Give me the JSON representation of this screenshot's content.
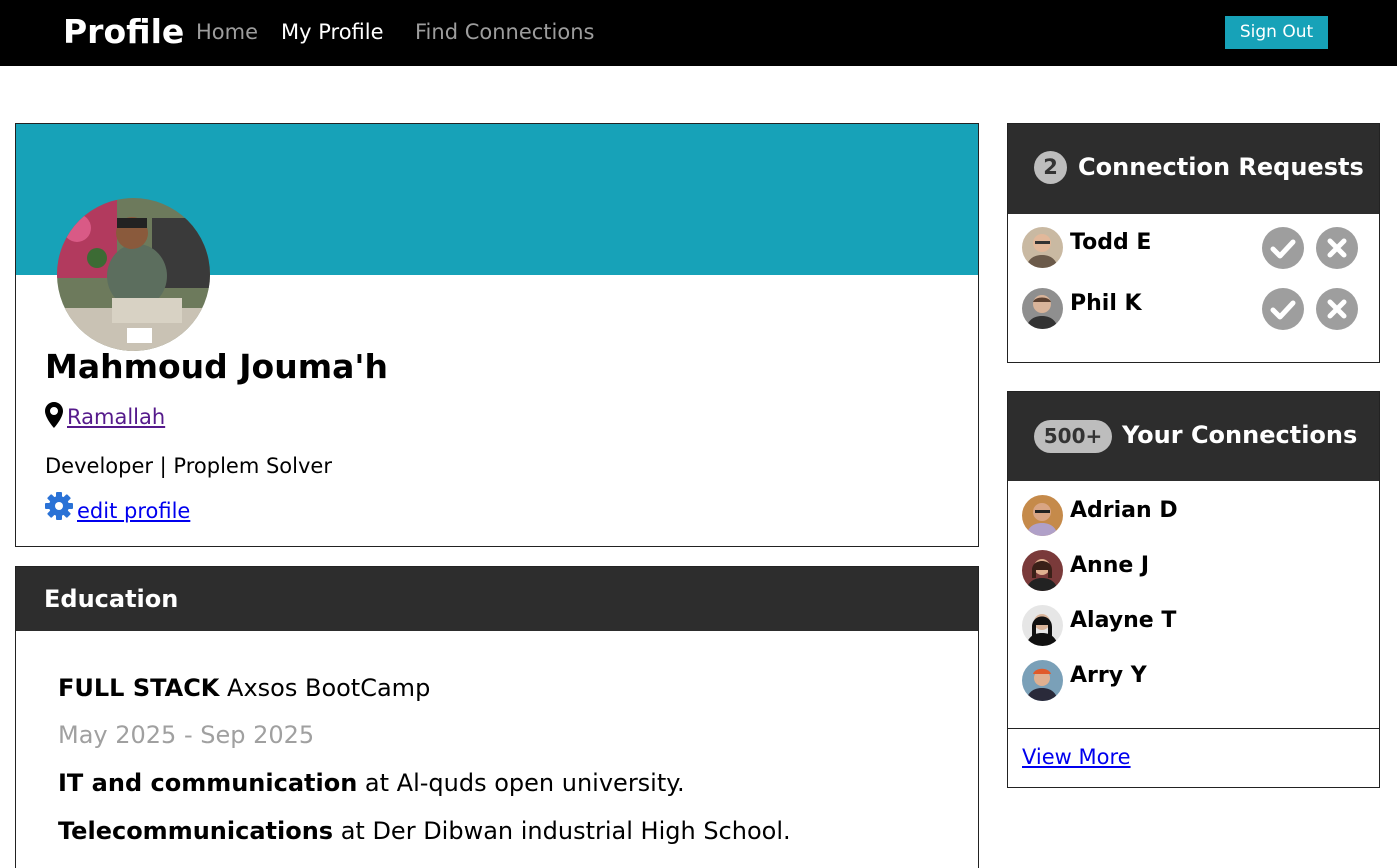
{
  "nav": {
    "brand": "Profile",
    "links": [
      "Home",
      "My Profile",
      "Find Connections"
    ],
    "sign_out": "Sign Out"
  },
  "profile": {
    "name": "Mahmoud Jouma'h",
    "location": "Ramallah",
    "headline": "Developer | Proplem Solver",
    "edit_label": "edit profile"
  },
  "education": {
    "title": "Education",
    "entries": [
      {
        "title": "FULL STACK",
        "place": " Axsos BootCamp"
      },
      {
        "dates": "May 2025 - Sep 2025"
      },
      {
        "title": "IT and communication",
        "place": " at Al-quds open university."
      },
      {
        "title": "Telecommunications",
        "place": " at Der Dibwan industrial High School."
      }
    ]
  },
  "requests": {
    "count": "2",
    "title": "Connection Requests",
    "people": [
      {
        "name": "Todd E"
      },
      {
        "name": "Phil K"
      }
    ]
  },
  "connections": {
    "count": "500+",
    "title": "Your Connections",
    "people": [
      {
        "name": "Adrian D"
      },
      {
        "name": "Anne J"
      },
      {
        "name": "Alayne T"
      },
      {
        "name": "Arry Y"
      }
    ],
    "view_more": "View More"
  },
  "colors": {
    "accent": "#17a2b8",
    "header_dark": "#2d2d2d",
    "badge": "#bdbdbd",
    "action_button": "#9e9e9e"
  },
  "icons": {
    "location": "map-pin-icon",
    "edit": "gear-icon",
    "accept": "check-icon",
    "reject": "close-icon"
  }
}
